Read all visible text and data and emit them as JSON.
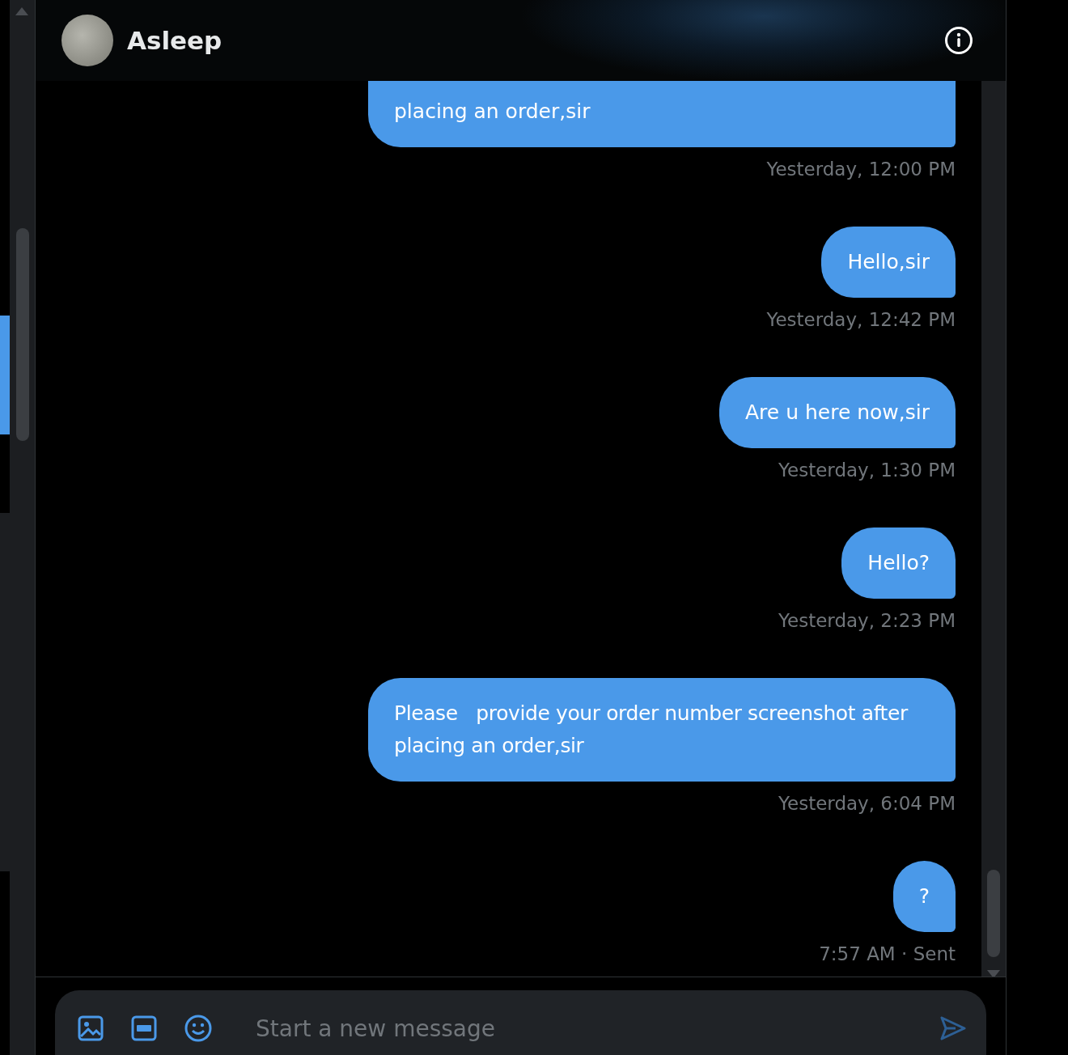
{
  "header": {
    "name": "Asleep"
  },
  "messages": [
    {
      "text": "placing an order,sir",
      "time": "Yesterday, 12:00 PM",
      "clipped": true
    },
    {
      "text": "Hello,sir",
      "time": "Yesterday, 12:42 PM",
      "clipped": false
    },
    {
      "text": "Are u here now,sir",
      "time": "Yesterday, 1:30 PM",
      "clipped": false
    },
    {
      "text": "Hello?",
      "time": "Yesterday, 2:23 PM",
      "clipped": false
    },
    {
      "text": "Please   provide your order number screenshot after placing an order,sir",
      "time": "Yesterday, 6:04 PM",
      "clipped": false
    },
    {
      "text": "?",
      "time": "7:57 AM · Sent",
      "clipped": false
    }
  ],
  "composer": {
    "placeholder": "Start a new message"
  }
}
